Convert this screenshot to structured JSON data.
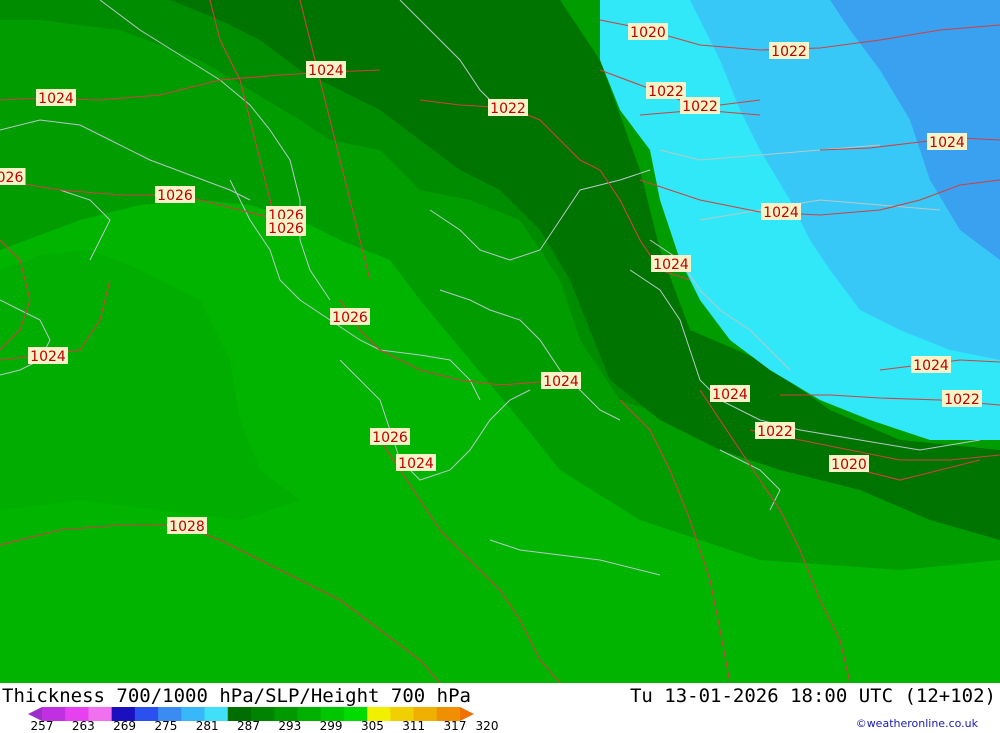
{
  "title_left": "Thickness 700/1000 hPa/SLP/Height 700 hPa",
  "title_right": "Tu 13-01-2026 18:00 UTC (12+102)",
  "credit": "©weatheronline.co.uk",
  "legend": {
    "ticks": [
      "257",
      "263",
      "269",
      "275",
      "281",
      "287",
      "293",
      "299",
      "305",
      "311",
      "317",
      "320"
    ],
    "colors": [
      "#9b2fc8",
      "#c030e0",
      "#e640f0",
      "#f070f0",
      "#1a10c0",
      "#2a50f0",
      "#3a8cf0",
      "#38b8f8",
      "#40e0f8",
      "#006e00",
      "#008400",
      "#009a00",
      "#00b000",
      "#00c600",
      "#00dc00",
      "#f0f000",
      "#f0d000",
      "#f0b000",
      "#f09000",
      "#f07000"
    ]
  },
  "isobars": [
    {
      "value": "1020",
      "label": "1020",
      "color": "#c00000"
    },
    {
      "value": "1022",
      "label": "1022",
      "color": "#c00000"
    },
    {
      "value": "1022",
      "label": "1022",
      "color": "#c00000"
    },
    {
      "value": "1022",
      "label": "1022",
      "color": "#c00000"
    },
    {
      "value": "1022",
      "label": "1022",
      "color": "#c00000"
    },
    {
      "value": "1024",
      "label": "1024",
      "color": "#c00000"
    },
    {
      "value": "1024",
      "label": "1024",
      "color": "#c00000"
    },
    {
      "value": "1024",
      "label": "1024",
      "color": "#c00000"
    },
    {
      "value": "1024",
      "label": "1024",
      "color": "#c00000"
    },
    {
      "value": "1026",
      "label": "026",
      "color": "#c00000"
    },
    {
      "value": "1026",
      "label": "1026",
      "color": "#c00000"
    },
    {
      "value": "1026",
      "label": "1026",
      "color": "#c00000"
    },
    {
      "value": "1026",
      "label": "1026",
      "color": "#c00000"
    },
    {
      "value": "1024",
      "label": "1024",
      "color": "#c00000"
    },
    {
      "value": "1026",
      "label": "1026",
      "color": "#c00000"
    },
    {
      "value": "1024",
      "label": "1024",
      "color": "#c00000"
    },
    {
      "value": "1024",
      "label": "1024",
      "color": "#c00000"
    },
    {
      "value": "1022",
      "label": "1022",
      "color": "#c00000"
    },
    {
      "value": "1022",
      "label": "1022",
      "color": "#c00000"
    },
    {
      "value": "1024",
      "label": "1024",
      "color": "#c00000"
    },
    {
      "value": "1020",
      "label": "1020",
      "color": "#c00000"
    },
    {
      "value": "1026",
      "label": "1026",
      "color": "#c00000"
    },
    {
      "value": "1024",
      "label": "1024",
      "color": "#c00000"
    },
    {
      "value": "1028",
      "label": "1028",
      "color": "#c00000"
    }
  ]
}
